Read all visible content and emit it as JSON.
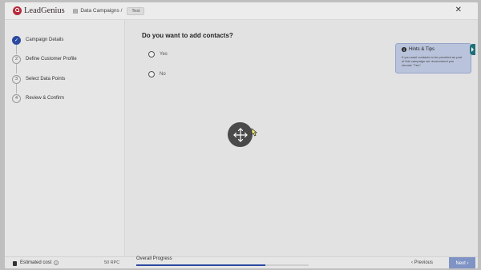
{
  "header": {
    "brand": "LeadGenius",
    "breadcrumb": "Data Campaigns /",
    "tag": "Test",
    "close_icon": "close-icon"
  },
  "steps": [
    {
      "number": "✓",
      "label": "Campaign Details",
      "status": "complete"
    },
    {
      "number": "2",
      "label": "Define Customer Profile",
      "status": "pending"
    },
    {
      "number": "3",
      "label": "Select Data Points",
      "status": "pending"
    },
    {
      "number": "4",
      "label": "Review & Confirm",
      "status": "pending"
    }
  ],
  "main": {
    "question": "Do you want to add contacts?",
    "options": [
      {
        "label": "Yes",
        "selected": false
      },
      {
        "label": "No",
        "selected": false
      }
    ]
  },
  "tips": {
    "title": "Hints & Tips",
    "body": "If you want contacts to be provided as part of this campaign we recommend you choose \"Yes\"."
  },
  "footer": {
    "estimated_cost_label": "Estimated cost",
    "cost_value": "50 RPC",
    "overall_progress_label": "Overall Progress",
    "progress_fraction": 0.75,
    "previous_label": "Previous",
    "next_label": "Next"
  },
  "colors": {
    "accent": "#2b4aa0",
    "brand": "#b62a3a",
    "tips_bg": "#b9c4dc",
    "next_button": "#7f94c4"
  }
}
